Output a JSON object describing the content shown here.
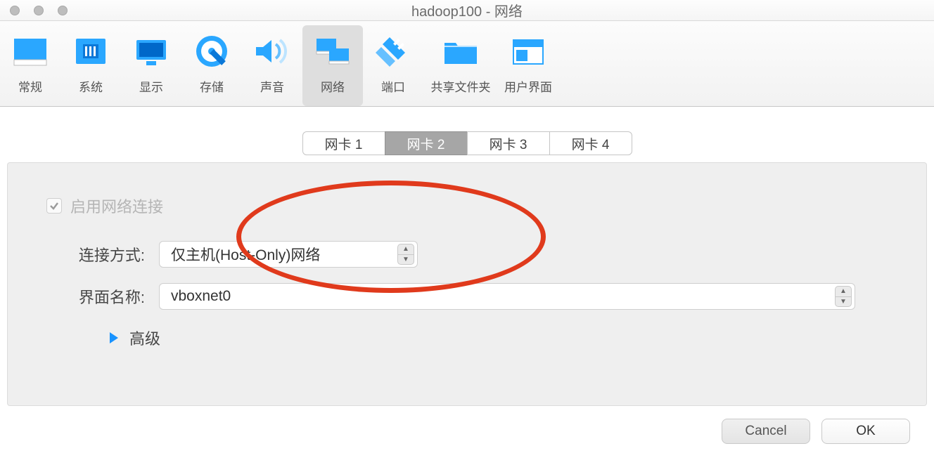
{
  "window": {
    "title": "hadoop100 - 网络"
  },
  "toolbar": {
    "items": [
      {
        "label": "常规"
      },
      {
        "label": "系统"
      },
      {
        "label": "显示"
      },
      {
        "label": "存储"
      },
      {
        "label": "声音"
      },
      {
        "label": "网络"
      },
      {
        "label": "端口"
      },
      {
        "label": "共享文件夹"
      },
      {
        "label": "用户界面"
      }
    ]
  },
  "tabs": {
    "items": [
      {
        "label": "网卡 1"
      },
      {
        "label": "网卡 2"
      },
      {
        "label": "网卡 3"
      },
      {
        "label": "网卡 4"
      }
    ]
  },
  "form": {
    "enable_label": "启用网络连接",
    "attached_label": "连接方式:",
    "attached_value": "仅主机(Host-Only)网络",
    "name_label": "界面名称:",
    "name_value": "vboxnet0",
    "advanced_label": "高级"
  },
  "footer": {
    "cancel": "Cancel",
    "ok": "OK"
  }
}
